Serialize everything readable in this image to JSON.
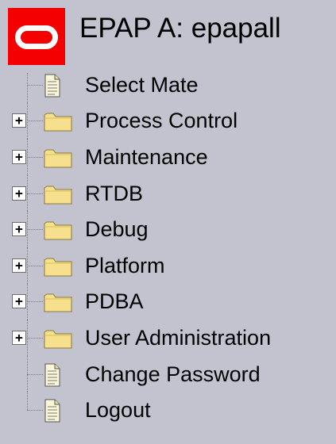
{
  "header": {
    "title": "EPAP A: epapall",
    "logo_icon": "oracle-logo",
    "logo_color": "#f50000"
  },
  "menu": {
    "items": [
      {
        "label": "Select Mate",
        "type": "page",
        "icon": "document-icon",
        "expandable": false
      },
      {
        "label": "Process Control",
        "type": "folder",
        "icon": "folder-icon",
        "expandable": true,
        "expander": "+"
      },
      {
        "label": "Maintenance",
        "type": "folder",
        "icon": "folder-icon",
        "expandable": true,
        "expander": "+"
      },
      {
        "label": "RTDB",
        "type": "folder",
        "icon": "folder-icon",
        "expandable": true,
        "expander": "+"
      },
      {
        "label": "Debug",
        "type": "folder",
        "icon": "folder-icon",
        "expandable": true,
        "expander": "+"
      },
      {
        "label": "Platform",
        "type": "folder",
        "icon": "folder-icon",
        "expandable": true,
        "expander": "+"
      },
      {
        "label": "PDBA",
        "type": "folder",
        "icon": "folder-icon",
        "expandable": true,
        "expander": "+"
      },
      {
        "label": "User Administration",
        "type": "folder",
        "icon": "folder-icon",
        "expandable": true,
        "expander": "+"
      },
      {
        "label": "Change Password",
        "type": "page",
        "icon": "document-icon",
        "expandable": false
      },
      {
        "label": "Logout",
        "type": "page",
        "icon": "document-icon",
        "expandable": false
      }
    ]
  },
  "colors": {
    "background": "#c3c3cf",
    "folder": "#f6e08e",
    "document": "#fbf7d8"
  }
}
